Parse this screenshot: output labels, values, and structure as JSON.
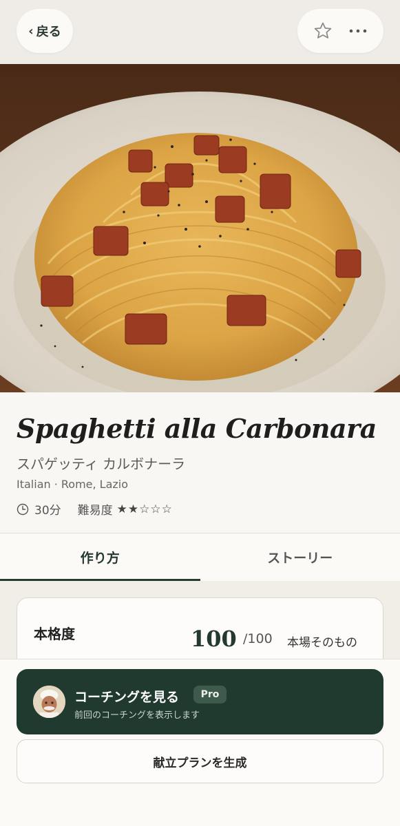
{
  "nav": {
    "back_label": "戻る",
    "favorite_icon": "star-outline-icon",
    "more_icon": "ellipsis-icon"
  },
  "hero": {
    "image": "spaghetti-carbonara-photo"
  },
  "recipe": {
    "title": "Spaghetti alla Carbonara",
    "subtitle": "スパゲッティ カルボナーラ",
    "origin": "Italian · Rome, Lazio",
    "time": "30分",
    "difficulty_label": "難易度",
    "difficulty_stars": "★★☆☆☆",
    "difficulty_value": 2,
    "difficulty_max": 5
  },
  "tabs": [
    {
      "label": "作り方",
      "active": true
    },
    {
      "label": "ストーリー",
      "active": false
    }
  ],
  "authenticity": {
    "label": "本格度",
    "score": "100",
    "max": "/100",
    "description": "本場そのもの"
  },
  "actions": {
    "coach_title": "コーチングを見る",
    "coach_badge": "Pro",
    "coach_subtitle": "前回のコーチングを表示します",
    "menu_plan_label": "献立プランを生成"
  },
  "colors": {
    "accent": "#213a30",
    "background": "#f6f3ee"
  }
}
